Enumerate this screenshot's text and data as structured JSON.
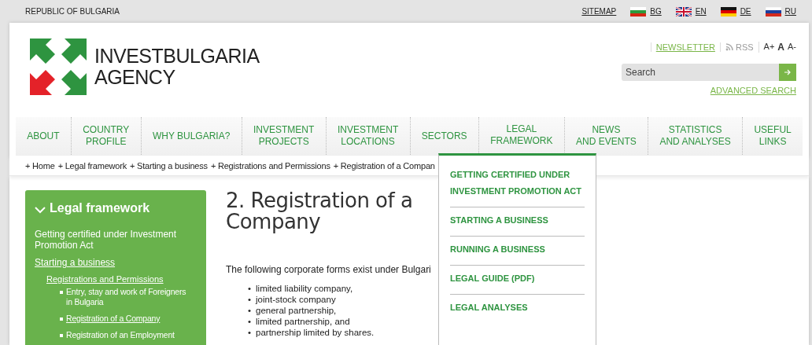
{
  "top_bar": {
    "country": "REPUBLIC OF BULGARIA",
    "sitemap": "SITEMAP",
    "languages": [
      {
        "code": "BG",
        "kind": "bg"
      },
      {
        "code": "EN",
        "kind": "en"
      },
      {
        "code": "DE",
        "kind": "de"
      },
      {
        "code": "RU",
        "kind": "ru"
      }
    ]
  },
  "header": {
    "logo_lines": [
      "INVESTBULGARIA",
      "AGENCY"
    ],
    "newsletter": "NEWSLETTER",
    "rss": "RSS",
    "font_sizes": [
      "A+",
      "A",
      "A-"
    ],
    "search": {
      "placeholder": "Search"
    },
    "advanced_search": "ADVANCED SEARCH"
  },
  "nav": [
    {
      "lines": [
        "ABOUT"
      ],
      "selected": false
    },
    {
      "lines": [
        "COUNTRY",
        "PROFILE"
      ],
      "selected": false
    },
    {
      "lines": [
        "WHY BULGARIA?"
      ],
      "selected": false
    },
    {
      "lines": [
        "INVESTMENT",
        "PROJECTS"
      ],
      "selected": false
    },
    {
      "lines": [
        "INVESTMENT",
        "LOCATIONS"
      ],
      "selected": false
    },
    {
      "lines": [
        "SECTORS"
      ],
      "selected": false
    },
    {
      "lines": [
        "LEGAL",
        "FRAMEWORK"
      ],
      "selected": true
    },
    {
      "lines": [
        "NEWS",
        "AND EVENTS"
      ],
      "selected": false
    },
    {
      "lines": [
        "STATISTICS",
        "AND ANALYSES"
      ],
      "selected": false
    },
    {
      "lines": [
        "USEFUL",
        "LINKS"
      ],
      "selected": false
    }
  ],
  "breadcrumb": [
    "+ Home",
    "+ Legal framework",
    "+ Starting a business",
    "+ Registrations and Permissions",
    "+ Registration of a Compan"
  ],
  "sidebar": {
    "title": "Legal framework",
    "items": [
      {
        "label": "Getting certified under Investment Promotion Act",
        "selected": false
      },
      {
        "label": "Starting a business",
        "selected": true,
        "children": [
          {
            "label": "Registrations and Permissions",
            "selected": true,
            "children": [
              {
                "label": "Entry, stay and work of Foreigners in Bulgaria",
                "selected": false
              },
              {
                "label": "Registration of a Company",
                "selected": true
              },
              {
                "label": "Registration of an Employment",
                "selected": false
              }
            ]
          }
        ]
      }
    ]
  },
  "article": {
    "title": "2. Registration of a Company",
    "intro": "The following corporate forms exist under Bulgari",
    "bullet": "•",
    "forms": [
      "limited liability company,",
      "joint-stock company",
      "general partnership,",
      "limited partnership, and",
      "partnership limited by shares."
    ]
  },
  "dropdown": [
    "GETTING CERTIFIED UNDER INVESTMENT PROMOTION ACT",
    "STARTING A BUSINESS",
    "RUNNING A BUSINESS",
    "LEGAL GUIDE (PDF)",
    "LEGAL ANALYSES"
  ]
}
